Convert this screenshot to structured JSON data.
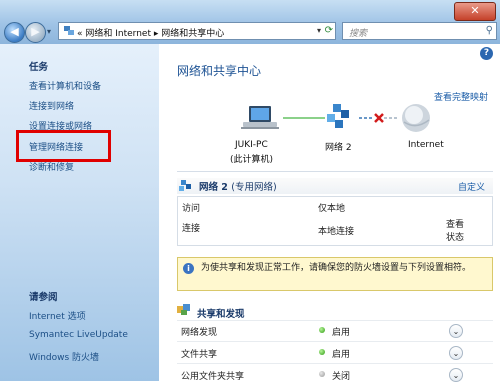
{
  "window": {
    "close_glyph": "✕"
  },
  "nav": {
    "back_glyph": "◀",
    "forward_glyph": "▶",
    "dropdown_glyph": "▾"
  },
  "address": {
    "separator": "«",
    "crumb1": "网络和 Internet",
    "crumb_sep": "▸",
    "crumb2": "网络和共享中心",
    "dropdown_glyph": "▾",
    "refresh_glyph": "⟳"
  },
  "search": {
    "placeholder": "搜索",
    "icon_glyph": "⚲"
  },
  "sidebar": {
    "tasks_title": "任务",
    "tasks": [
      "查看计算机和设备",
      "连接到网络",
      "设置连接或网络",
      "管理网络连接",
      "诊断和修复"
    ],
    "see_also_title": "请参阅",
    "see_also": [
      "Internet 选项",
      "Symantec LiveUpdate",
      "Windows 防火墙"
    ]
  },
  "main": {
    "help_glyph": "?",
    "title": "网络和共享中心",
    "view_full_map": "查看完整映射",
    "nodes": {
      "computer_name": "JUKI-PC",
      "computer_sub": "(此计算机)",
      "network": "网络  2",
      "internet": "Internet"
    },
    "network_section": {
      "name": "网络 2",
      "type": "(专用网络)",
      "customize": "自定义",
      "rows": [
        {
          "label": "访问",
          "value": "仅本地"
        },
        {
          "label": "连接",
          "value": "本地连接"
        }
      ],
      "view_status_line1": "查看",
      "view_status_line2": "状态"
    },
    "info_text": "为使共享和发现正常工作，请确保您的防火墙设置与下列设置相符。",
    "sharing": {
      "title": "共享和发现",
      "rows": [
        {
          "label": "网络发现",
          "status": "启用"
        },
        {
          "label": "文件共享",
          "status": "启用"
        },
        {
          "label": "公用文件夹共享",
          "status": "关闭"
        }
      ],
      "chevron_glyph": "⌄"
    }
  },
  "colors": {
    "accent_link": "#1c5ea8",
    "highlight_box": "#e00000",
    "status_on": "#2e9a12",
    "status_off": "#9a9a9a"
  }
}
